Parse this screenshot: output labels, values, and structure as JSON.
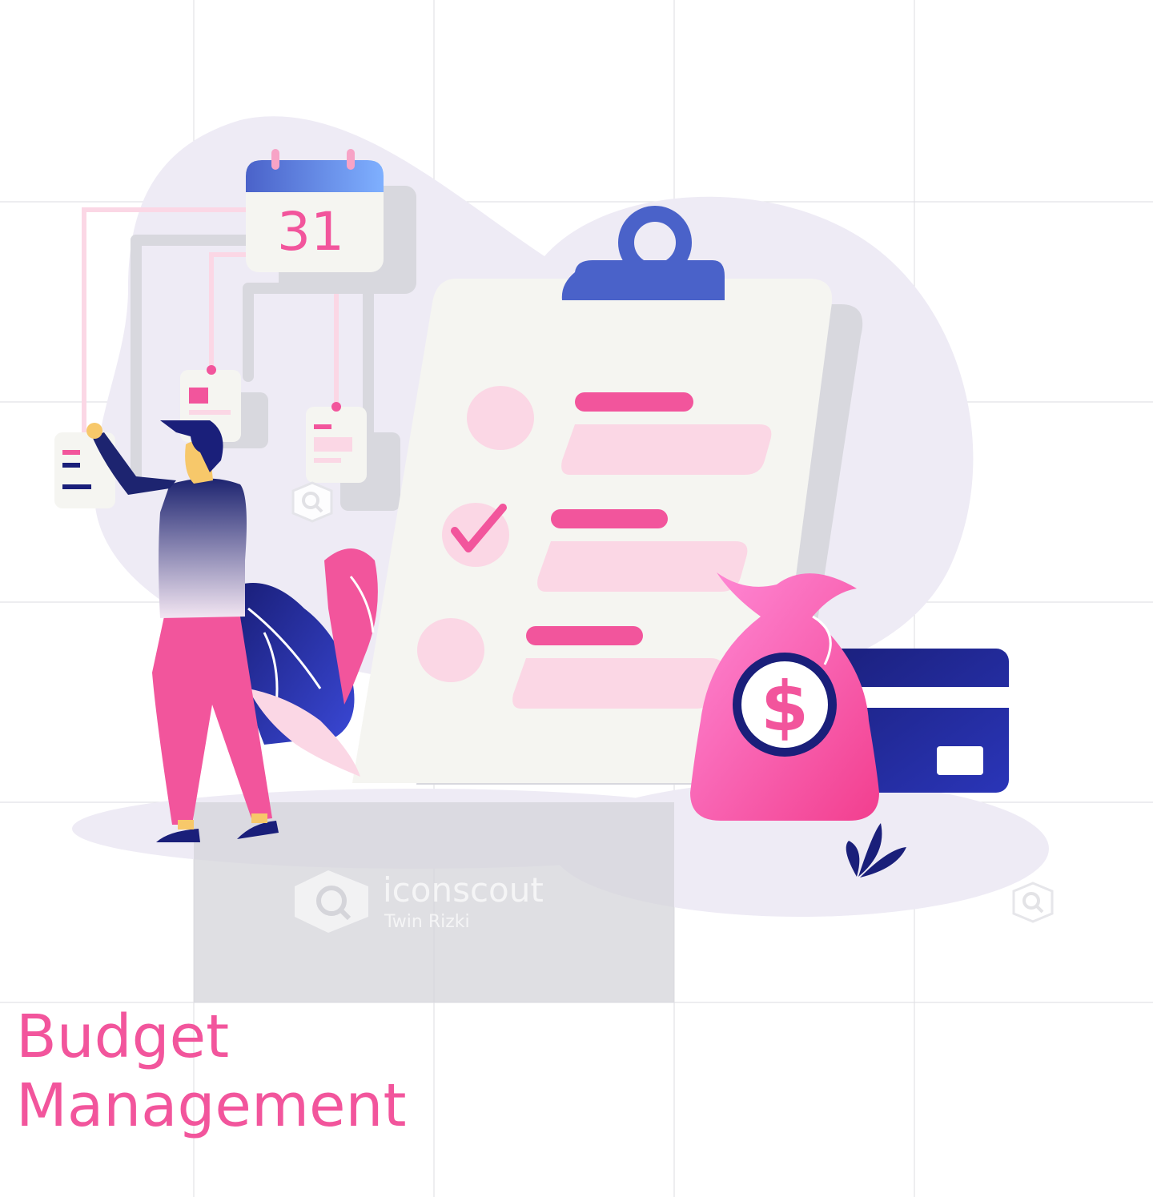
{
  "illustration": {
    "calendar_day": "31",
    "watermark": {
      "brand": "iconscout",
      "author": "Twin Rizki"
    },
    "colors": {
      "accent_pink": "#f2559c",
      "navy": "#1a1f7a",
      "blue": "#4a62c9",
      "blob_lavender": "#eeebf5",
      "paper": "#f5f5f1",
      "grid_line": "#e2e2e6"
    }
  },
  "title": {
    "line1": "Budget",
    "line2": "Management"
  }
}
